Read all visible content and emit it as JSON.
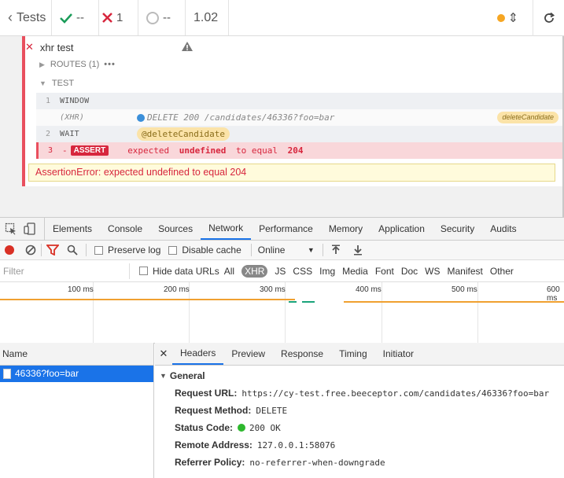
{
  "header": {
    "tests_label": "Tests",
    "passed": "--",
    "failed": "1",
    "pending": "--",
    "duration": "1.02"
  },
  "reporter": {
    "test_title": "xhr test",
    "routes_label": "ROUTES (1)",
    "routes_more": "•••",
    "test_section_label": "TEST",
    "commands": [
      {
        "num": "1",
        "name": "WINDOW",
        "message": ""
      },
      {
        "num": "",
        "name": "(XHR)",
        "message": "DELETE 200 /candidates/46336?foo=bar",
        "alias": "deleteCandidate"
      },
      {
        "num": "2",
        "name": "WAIT",
        "message": "@deleteCandidate"
      },
      {
        "num": "3",
        "name": "ASSERT",
        "prefix": "-",
        "msg_expected": "expected",
        "msg_value": "undefined",
        "msg_to_equal": "to equal",
        "msg_number": "204"
      }
    ],
    "error_message": "AssertionError: expected undefined to equal 204"
  },
  "devtools": {
    "tabs": [
      "Elements",
      "Console",
      "Sources",
      "Network",
      "Performance",
      "Memory",
      "Application",
      "Security",
      "Audits"
    ],
    "active_tab": "Network",
    "toolbar": {
      "preserve_log": "Preserve log",
      "disable_cache": "Disable cache",
      "throttling": "Online"
    },
    "filter": {
      "placeholder": "Filter",
      "hide_data_urls": "Hide data URLs",
      "types": [
        "All",
        "XHR",
        "JS",
        "CSS",
        "Img",
        "Media",
        "Font",
        "Doc",
        "WS",
        "Manifest",
        "Other"
      ],
      "active_type": "XHR"
    },
    "timeline_marks": [
      "100 ms",
      "200 ms",
      "300 ms",
      "400 ms",
      "500 ms",
      "600 ms"
    ],
    "requests_header": "Name",
    "requests": [
      "46336?foo=bar"
    ],
    "detail_tabs": [
      "Headers",
      "Preview",
      "Response",
      "Timing",
      "Initiator"
    ],
    "active_detail_tab": "Headers",
    "general_label": "General",
    "headers": [
      {
        "key": "Request URL:",
        "value": "https://cy-test.free.beeceptor.com/candidates/46336?foo=bar"
      },
      {
        "key": "Request Method:",
        "value": "DELETE"
      },
      {
        "key": "Status Code:",
        "value": "200 OK",
        "status_color": "#2eb82e"
      },
      {
        "key": "Remote Address:",
        "value": "127.0.0.1:58076"
      },
      {
        "key": "Referrer Policy:",
        "value": "no-referrer-when-downgrade"
      }
    ]
  },
  "colors": {
    "fail": "#d7263d",
    "pass": "#1a9c59",
    "accent": "#1a73e8",
    "alias_bg": "#fbe3a8"
  }
}
